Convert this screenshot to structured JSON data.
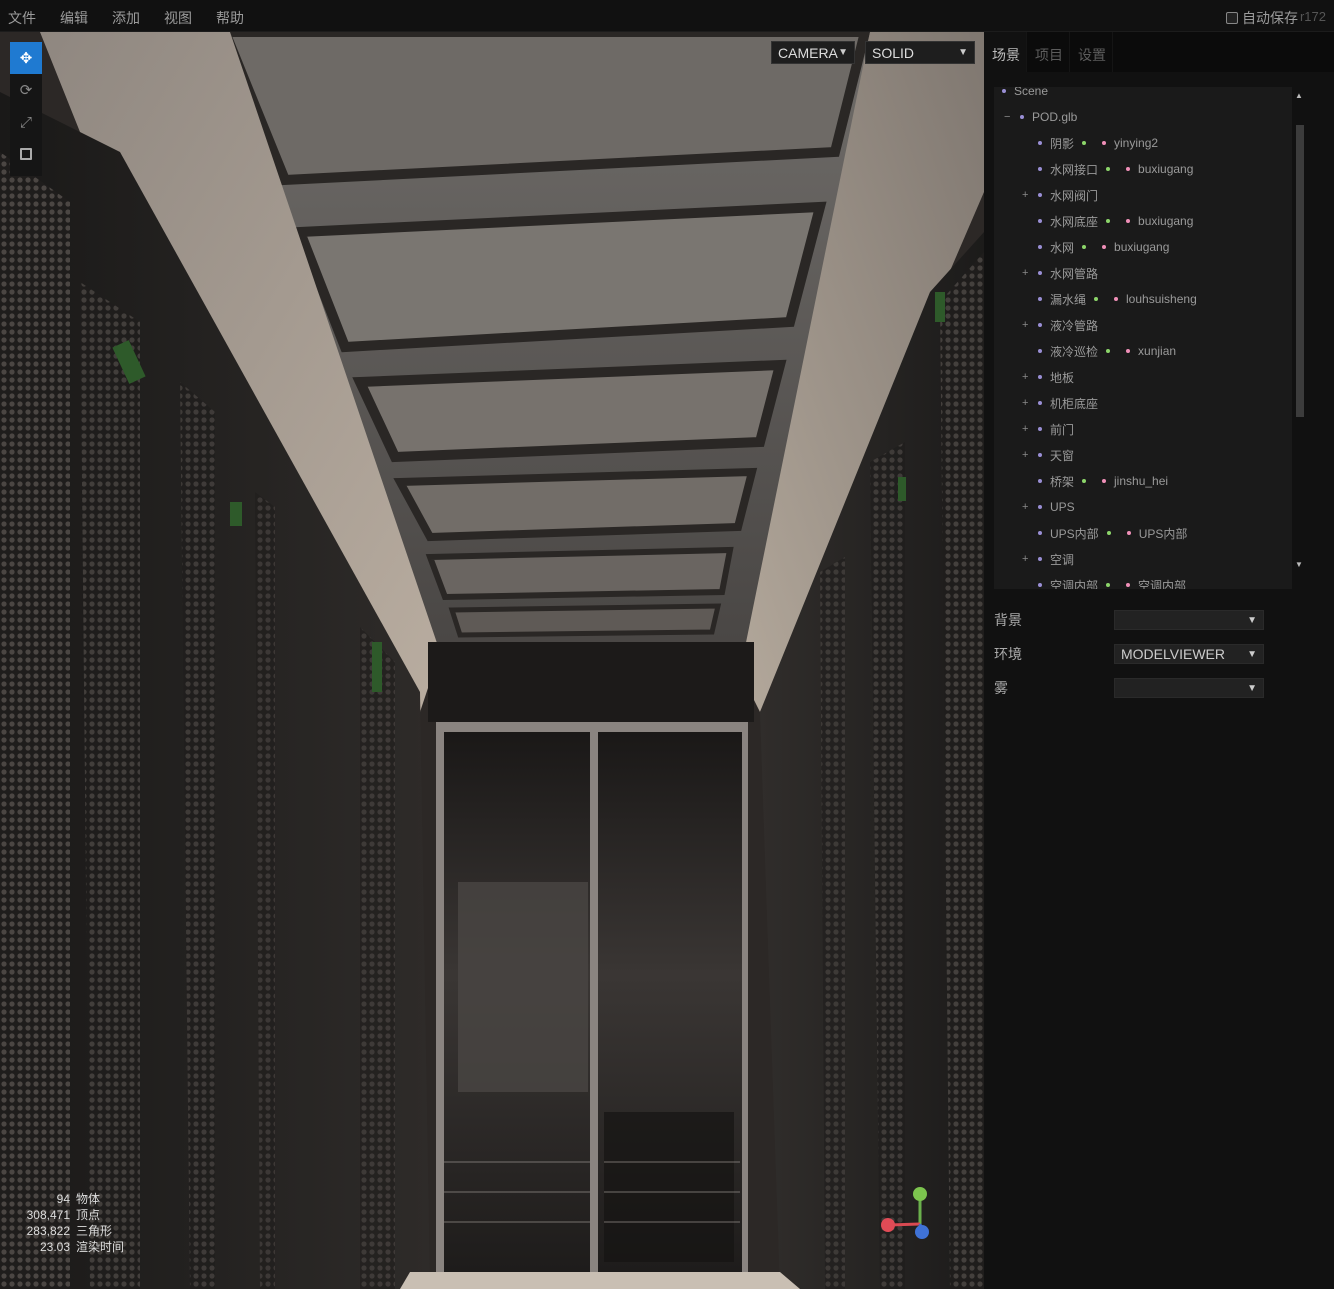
{
  "menubar": {
    "items": [
      "文件",
      "编辑",
      "添加",
      "视图",
      "帮助"
    ],
    "autosave_label": "自动保存",
    "version": "r172"
  },
  "viewport": {
    "camera_select": "CAMERA",
    "shading_select": "SOLID",
    "tools": [
      "translate-icon",
      "rotate-icon",
      "scale-icon",
      "toggle-icon"
    ],
    "info": [
      {
        "value": "94",
        "label": "物体"
      },
      {
        "value": "308,471",
        "label": "顶点"
      },
      {
        "value": "283,822",
        "label": "三角形"
      },
      {
        "value": "23.03",
        "label": "渲染时间"
      }
    ]
  },
  "sidebar": {
    "tabs": [
      "场景",
      "项目",
      "设置"
    ],
    "outliner": [
      {
        "name": "Scene"
      },
      {
        "name": "POD.glb",
        "expander": "−"
      },
      {
        "name": "阴影",
        "geometry": " ",
        "material": "yinying2"
      },
      {
        "name": "水网接口",
        "geometry": " ",
        "material": "buxiugang"
      },
      {
        "name": "水网阀门",
        "expander": "+"
      },
      {
        "name": "水网底座",
        "geometry": " ",
        "material": "buxiugang"
      },
      {
        "name": "水网",
        "geometry": " ",
        "material": "buxiugang"
      },
      {
        "name": "水网管路",
        "expander": "+"
      },
      {
        "name": "漏水绳",
        "geometry": " ",
        "material": "louhsuisheng"
      },
      {
        "name": "液冷管路",
        "expander": "+"
      },
      {
        "name": "液冷巡检",
        "geometry": " ",
        "material": "xunjian"
      },
      {
        "name": "地板",
        "expander": "+"
      },
      {
        "name": "机柜底座",
        "expander": "+"
      },
      {
        "name": "前门",
        "expander": "+"
      },
      {
        "name": "天窗",
        "expander": "+"
      },
      {
        "name": "桥架",
        "geometry": " ",
        "material": "jinshu_hei"
      },
      {
        "name": "UPS",
        "expander": "+"
      },
      {
        "name": "UPS内部",
        "geometry": " ",
        "material": "UPS内部"
      },
      {
        "name": "空调",
        "expander": "+"
      },
      {
        "name": "空调内部",
        "geometry": " ",
        "material": "空调内部"
      }
    ],
    "properties": [
      {
        "label": "背景",
        "value": ""
      },
      {
        "label": "环境",
        "value": "MODELVIEWER"
      },
      {
        "label": "雾",
        "value": ""
      }
    ]
  },
  "colors": {
    "accent": "#1f7ad1",
    "object_dot": "#9a8fd5",
    "geometry_dot": "#8cd66a",
    "material_dot": "#f08fb8"
  }
}
